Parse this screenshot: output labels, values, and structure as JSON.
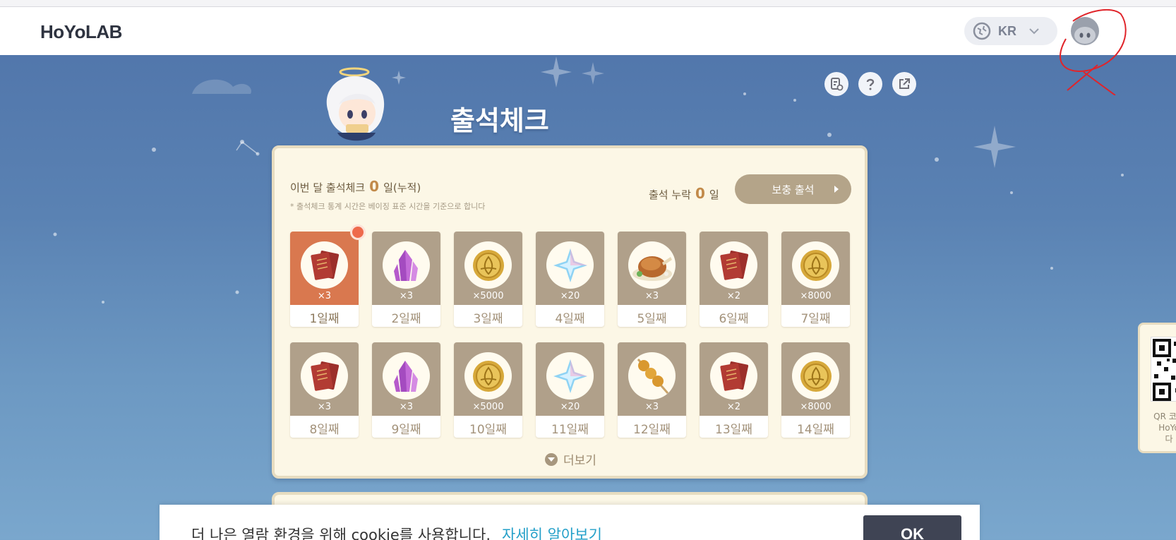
{
  "header": {
    "logo": "HoYoLAB",
    "region_code": "KR"
  },
  "page": {
    "title": "출석체크"
  },
  "summary": {
    "month_label": "이번 달 출석체크",
    "month_count": "0",
    "month_unit": "일(누적)",
    "note": "* 출석체크 통계 시간은 베이징 표준 시간을 기준으로 합니다",
    "missed_label": "출석 누락",
    "missed_count": "0",
    "missed_unit": "일",
    "makeup_button": "보충 출석"
  },
  "days": [
    {
      "label": "1일째",
      "qty": "×3",
      "item": "book-icon"
    },
    {
      "label": "2일째",
      "qty": "×3",
      "item": "crystal-icon"
    },
    {
      "label": "3일째",
      "qty": "×5000",
      "item": "coin-icon"
    },
    {
      "label": "4일째",
      "qty": "×20",
      "item": "primogem-icon"
    },
    {
      "label": "5일째",
      "qty": "×3",
      "item": "chicken-icon"
    },
    {
      "label": "6일째",
      "qty": "×2",
      "item": "book-icon"
    },
    {
      "label": "7일째",
      "qty": "×8000",
      "item": "coin-icon"
    },
    {
      "label": "8일째",
      "qty": "×3",
      "item": "book-icon"
    },
    {
      "label": "9일째",
      "qty": "×3",
      "item": "crystal-icon"
    },
    {
      "label": "10일째",
      "qty": "×5000",
      "item": "coin-icon"
    },
    {
      "label": "11일째",
      "qty": "×20",
      "item": "primogem-icon"
    },
    {
      "label": "12일째",
      "qty": "×3",
      "item": "skewer-icon"
    },
    {
      "label": "13일째",
      "qty": "×2",
      "item": "book-icon"
    },
    {
      "label": "14일째",
      "qty": "×8000",
      "item": "coin-icon"
    }
  ],
  "more_label": "더보기",
  "qr_panel": {
    "text_line1": "QR 코드",
    "text_line2": "HoYo",
    "text_line3": "다"
  },
  "cookie": {
    "message": "더 나은 열람 환경을 위해 cookie를 사용합니다.",
    "link": "자세히 알아보기",
    "ok": "OK"
  },
  "colors": {
    "background": "#5a82b3",
    "card": "#fcf7e6",
    "tile": "#b0a08a",
    "active_tile": "#d9784f",
    "accent_number": "#c28a4a",
    "link": "#24a0c9",
    "annotation": "#e0242a"
  }
}
